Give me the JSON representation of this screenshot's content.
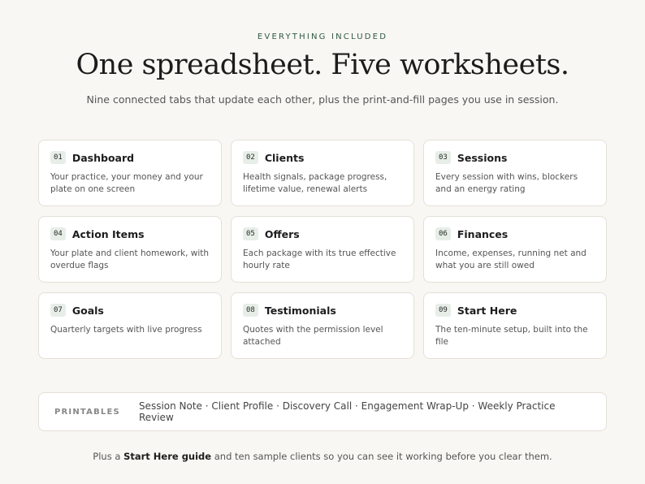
{
  "header": {
    "eyebrow": "EVERYTHING INCLUDED",
    "title": "One spreadsheet. Five worksheets.",
    "subtitle": "Nine connected tabs that update each other, plus the print-and-fill pages you use in session."
  },
  "tabs": [
    {
      "num": "01",
      "title": "Dashboard",
      "desc": "Your practice, your money and your plate on one screen"
    },
    {
      "num": "02",
      "title": "Clients",
      "desc": "Health signals, package progress, lifetime value, renewal alerts"
    },
    {
      "num": "03",
      "title": "Sessions",
      "desc": "Every session with wins, blockers and an energy rating"
    },
    {
      "num": "04",
      "title": "Action Items",
      "desc": "Your plate and client homework, with overdue flags"
    },
    {
      "num": "05",
      "title": "Offers",
      "desc": "Each package with its true effective hourly rate"
    },
    {
      "num": "06",
      "title": "Finances",
      "desc": "Income, expenses, running net and what you are still owed"
    },
    {
      "num": "07",
      "title": "Goals",
      "desc": "Quarterly targets with live progress"
    },
    {
      "num": "08",
      "title": "Testimonials",
      "desc": "Quotes with the permission level attached"
    },
    {
      "num": "09",
      "title": "Start Here",
      "desc": "The ten-minute setup, built into the file"
    }
  ],
  "printables": {
    "label": "PRINTABLES",
    "items": "Session Note · Client Profile · Discovery Call · Engagement Wrap-Up · Weekly Practice Review"
  },
  "footer": {
    "prefix": "Plus a ",
    "bold": "Start Here guide",
    "suffix": " and ten sample clients so you can see it working before you clear them."
  }
}
